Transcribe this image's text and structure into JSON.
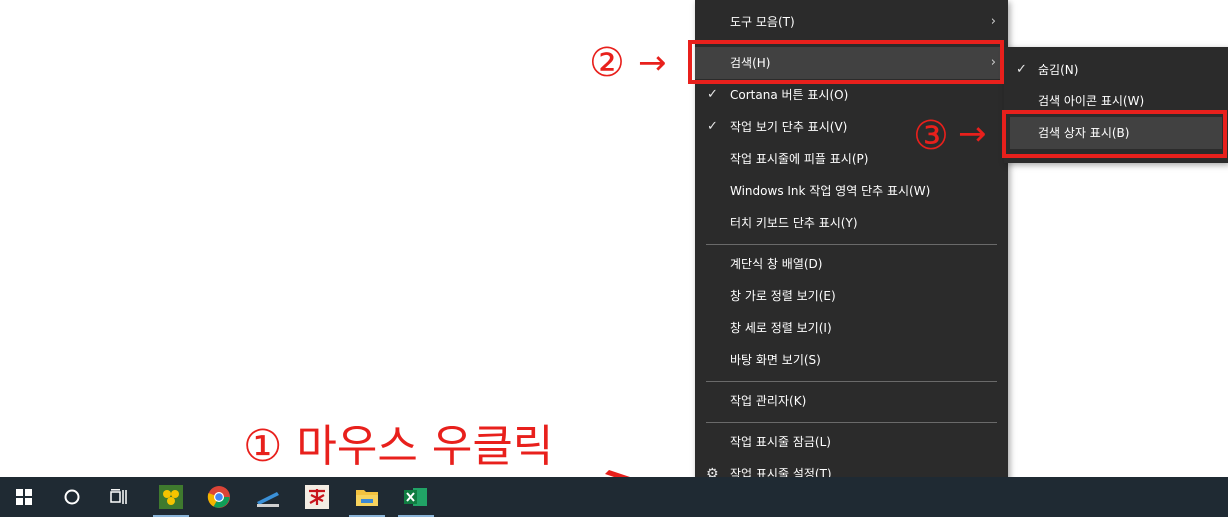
{
  "menu": {
    "items": [
      {
        "label": "도구 모음(T)",
        "checked": false,
        "submenu": true
      },
      {
        "label": "검색(H)",
        "checked": false,
        "submenu": true,
        "highlighted": true
      },
      {
        "label": "Cortana 버튼 표시(O)",
        "checked": true
      },
      {
        "label": "작업 보기 단추 표시(V)",
        "checked": true
      },
      {
        "label": "작업 표시줄에 피플 표시(P)",
        "checked": false
      },
      {
        "label": "Windows Ink 작업 영역 단추 표시(W)",
        "checked": false
      },
      {
        "label": "터치 키보드 단추 표시(Y)",
        "checked": false
      },
      {
        "label": "계단식 창 배열(D)",
        "checked": false
      },
      {
        "label": "창 가로 정렬 보기(E)",
        "checked": false
      },
      {
        "label": "창 세로 정렬 보기(I)",
        "checked": false
      },
      {
        "label": "바탕 화면 보기(S)",
        "checked": false
      },
      {
        "label": "작업 관리자(K)",
        "checked": false
      },
      {
        "label": "작업 표시줄 잠금(L)",
        "checked": false
      },
      {
        "label": "작업 표시줄 설정(T)",
        "checked": false,
        "icon": "gear-icon"
      }
    ],
    "check_glyph": "✓",
    "arrow_glyph": "›",
    "gear_glyph": "⚙"
  },
  "submenu": {
    "items": [
      {
        "label": "숨김(N)",
        "checked": true
      },
      {
        "label": "검색 아이콘 표시(W)",
        "checked": false
      },
      {
        "label": "검색 상자 표시(B)",
        "checked": false,
        "highlighted": true
      }
    ]
  },
  "annotations": {
    "step1": "① 마우스 우클릭",
    "step2": "②",
    "step3": "③",
    "arrow": "→",
    "color": "#e8201c"
  },
  "taskbar": {
    "icons": [
      {
        "name": "start-icon",
        "glyph": "⊞"
      },
      {
        "name": "cortana-icon",
        "glyph": "○"
      },
      {
        "name": "task-view-icon",
        "glyph": "task-view"
      },
      {
        "name": "app-icon-yellow",
        "glyph": "app"
      },
      {
        "name": "chrome-icon",
        "glyph": "chrome"
      },
      {
        "name": "scanner-icon",
        "glyph": "scanner"
      },
      {
        "name": "app-icon-red",
        "glyph": "app-red"
      },
      {
        "name": "file-explorer-icon",
        "glyph": "folder"
      },
      {
        "name": "excel-icon",
        "glyph": "X"
      }
    ],
    "background": "#1f2a33"
  }
}
